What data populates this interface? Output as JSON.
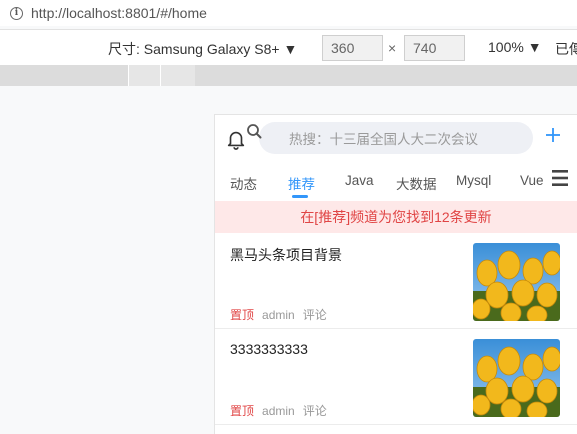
{
  "browser": {
    "url": "http://localhost:8801/#/home"
  },
  "devtools": {
    "device_label": "尺寸: Samsung Galaxy S8+ ▼",
    "width": "360",
    "times": "×",
    "height": "740",
    "zoom": "100% ▼",
    "more": "已傳"
  },
  "app": {
    "search_placeholder": "热搜：十三届全国人大二次会议",
    "tabs": [
      "动态",
      "推荐",
      "Java",
      "大数据",
      "Mysql",
      "Vue"
    ],
    "active_tab": "推荐",
    "notice": "在[推荐]频道为您找到12条更新",
    "articles": [
      {
        "title": "黑马头条项目背景",
        "tag": "置顶",
        "author": "admin",
        "comment": "评论"
      },
      {
        "title": "3333333333",
        "tag": "置顶",
        "author": "admin",
        "comment": "评论"
      }
    ]
  },
  "colors": {
    "accent": "#3296fa",
    "notice_bg": "#fee8e8",
    "notice_text": "#e04545"
  }
}
